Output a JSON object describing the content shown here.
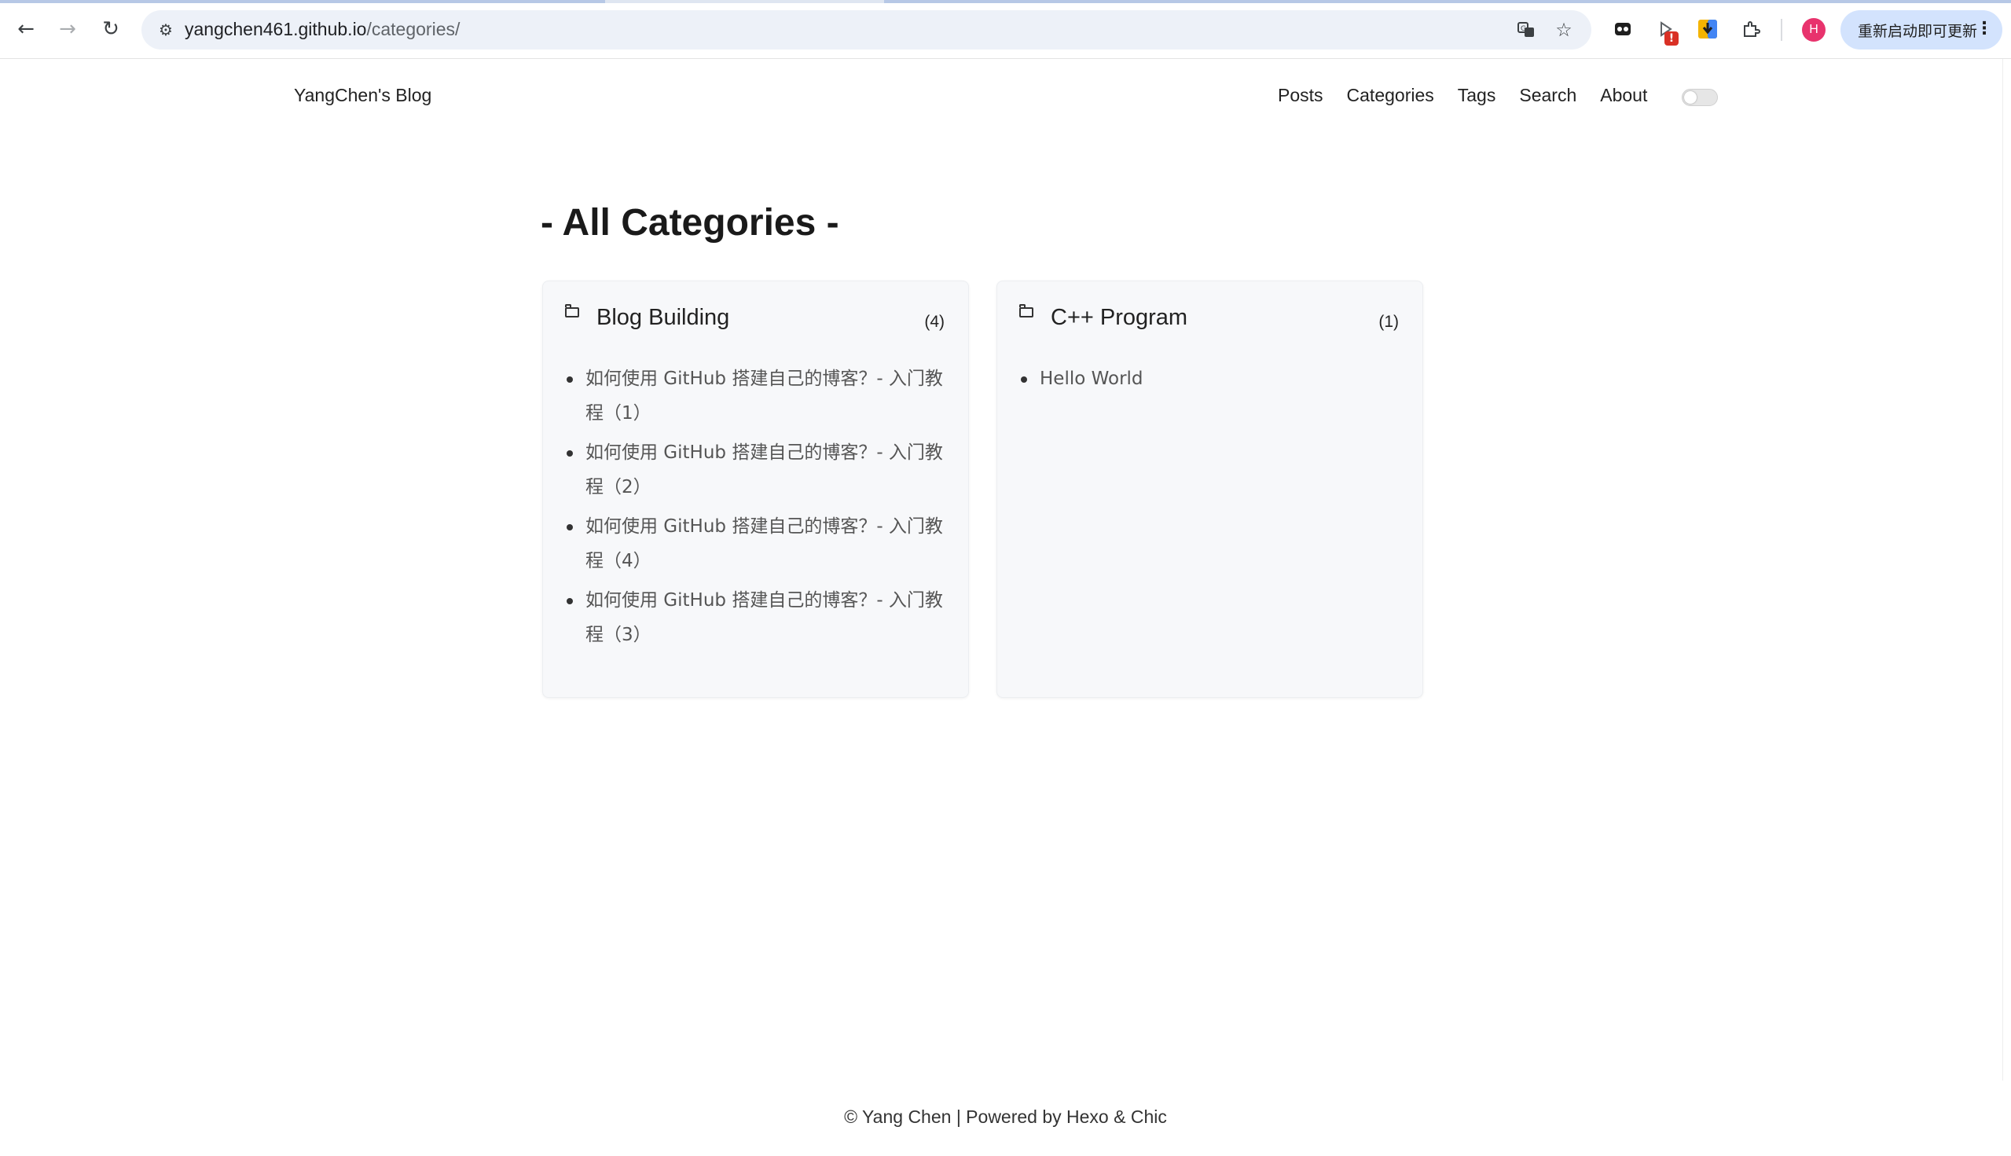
{
  "browser": {
    "url_host": "yangchen461.github.io",
    "url_path": "/categories/",
    "update_button_label": "重新启动即可更新",
    "avatar_initial": "H",
    "extension_badge": "!",
    "icons": {
      "back": "arrow-left-icon",
      "forward": "arrow-right-icon",
      "reload": "reload-icon",
      "site_info": "tune-icon",
      "translate": "translate-icon",
      "bookmark": "star-icon",
      "extensions": "puzzle-icon",
      "menu": "kebab-menu-icon"
    }
  },
  "site": {
    "title": "YangChen's Blog",
    "nav": [
      {
        "label": "Posts"
      },
      {
        "label": "Categories"
      },
      {
        "label": "Tags"
      },
      {
        "label": "Search"
      },
      {
        "label": "About"
      }
    ]
  },
  "page": {
    "heading": "- All Categories -"
  },
  "categories": [
    {
      "name": "Blog Building",
      "count": "(4)",
      "posts": [
        "如何使用 GitHub 搭建自己的博客？- 入门教程（1）",
        "如何使用 GitHub 搭建自己的博客？- 入门教程（2）",
        "如何使用 GitHub 搭建自己的博客？- 入门教程（4）",
        "如何使用 GitHub 搭建自己的博客？- 入门教程（3）"
      ]
    },
    {
      "name": "C++ Program",
      "count": "(1)",
      "posts": [
        "Hello World"
      ]
    }
  ],
  "footer": {
    "text": "© Yang Chen | Powered by Hexo & Chic"
  },
  "colors": {
    "card_background": "#f7f8fa",
    "update_button": "#d3e3fd",
    "avatar": "#e8336d",
    "omnibox": "#edf1f8"
  }
}
